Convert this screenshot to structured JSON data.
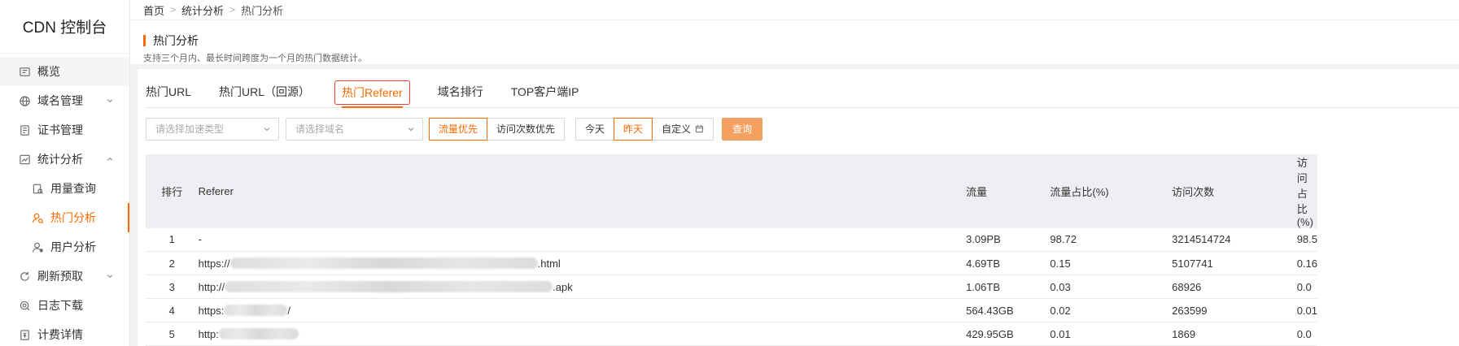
{
  "sidebar": {
    "title": "CDN 控制台",
    "items": [
      {
        "label": "概览",
        "icon": "overview-icon"
      },
      {
        "label": "域名管理",
        "icon": "globe-icon"
      },
      {
        "label": "证书管理",
        "icon": "certificate-icon"
      },
      {
        "label": "统计分析",
        "icon": "chart-icon"
      },
      {
        "label": "用量查询",
        "icon": "usage-icon"
      },
      {
        "label": "热门分析",
        "icon": "hot-analysis-icon"
      },
      {
        "label": "用户分析",
        "icon": "user-icon"
      },
      {
        "label": "刷新预取",
        "icon": "refresh-icon"
      },
      {
        "label": "日志下载",
        "icon": "log-icon"
      },
      {
        "label": "计费详情",
        "icon": "billing-icon"
      }
    ]
  },
  "breadcrumb": {
    "home": "首页",
    "parent": "统计分析",
    "current": "热门分析"
  },
  "header": {
    "title": "热门分析",
    "desc": "支持三个月内、最长时间跨度为一个月的热门数据统计。"
  },
  "tabs": [
    "热门URL",
    "热门URL（回源）",
    "热门Referer",
    "域名排行",
    "TOP客户端IP"
  ],
  "filters": {
    "accel_type_placeholder": "请选择加速类型",
    "domain_placeholder": "请选择域名",
    "sort_flow": "流量优先",
    "sort_visits": "访问次数优先",
    "today": "今天",
    "yesterday": "昨天",
    "custom": "自定义",
    "query": "查询"
  },
  "table": {
    "columns": [
      "排行",
      "Referer",
      "流量",
      "流量占比(%)",
      "访问次数",
      "访问占比(%)"
    ],
    "rows": [
      {
        "rank": "1",
        "ref_prefix": "-",
        "ref_suffix": "",
        "flow": "3.09PB",
        "flow_ratio": "98.72",
        "visits": "3214514724",
        "visit_ratio": "98.5"
      },
      {
        "rank": "2",
        "ref_prefix": "https://",
        "ref_suffix": ".html",
        "flow": "4.69TB",
        "flow_ratio": "0.15",
        "visits": "5107741",
        "visit_ratio": "0.16"
      },
      {
        "rank": "3",
        "ref_prefix": "http://",
        "ref_suffix": ".apk",
        "flow": "1.06TB",
        "flow_ratio": "0.03",
        "visits": "68926",
        "visit_ratio": "0.0"
      },
      {
        "rank": "4",
        "ref_prefix": "https:",
        "ref_suffix": "/",
        "flow": "564.43GB",
        "flow_ratio": "0.02",
        "visits": "263599",
        "visit_ratio": "0.01"
      },
      {
        "rank": "5",
        "ref_prefix": "http:",
        "ref_suffix": "",
        "flow": "429.95GB",
        "flow_ratio": "0.01",
        "visits": "1869",
        "visit_ratio": "0.0"
      }
    ]
  },
  "colors": {
    "accent": "#ff6a00",
    "query_button": "#f5a060",
    "table_header": "#edeff2"
  }
}
